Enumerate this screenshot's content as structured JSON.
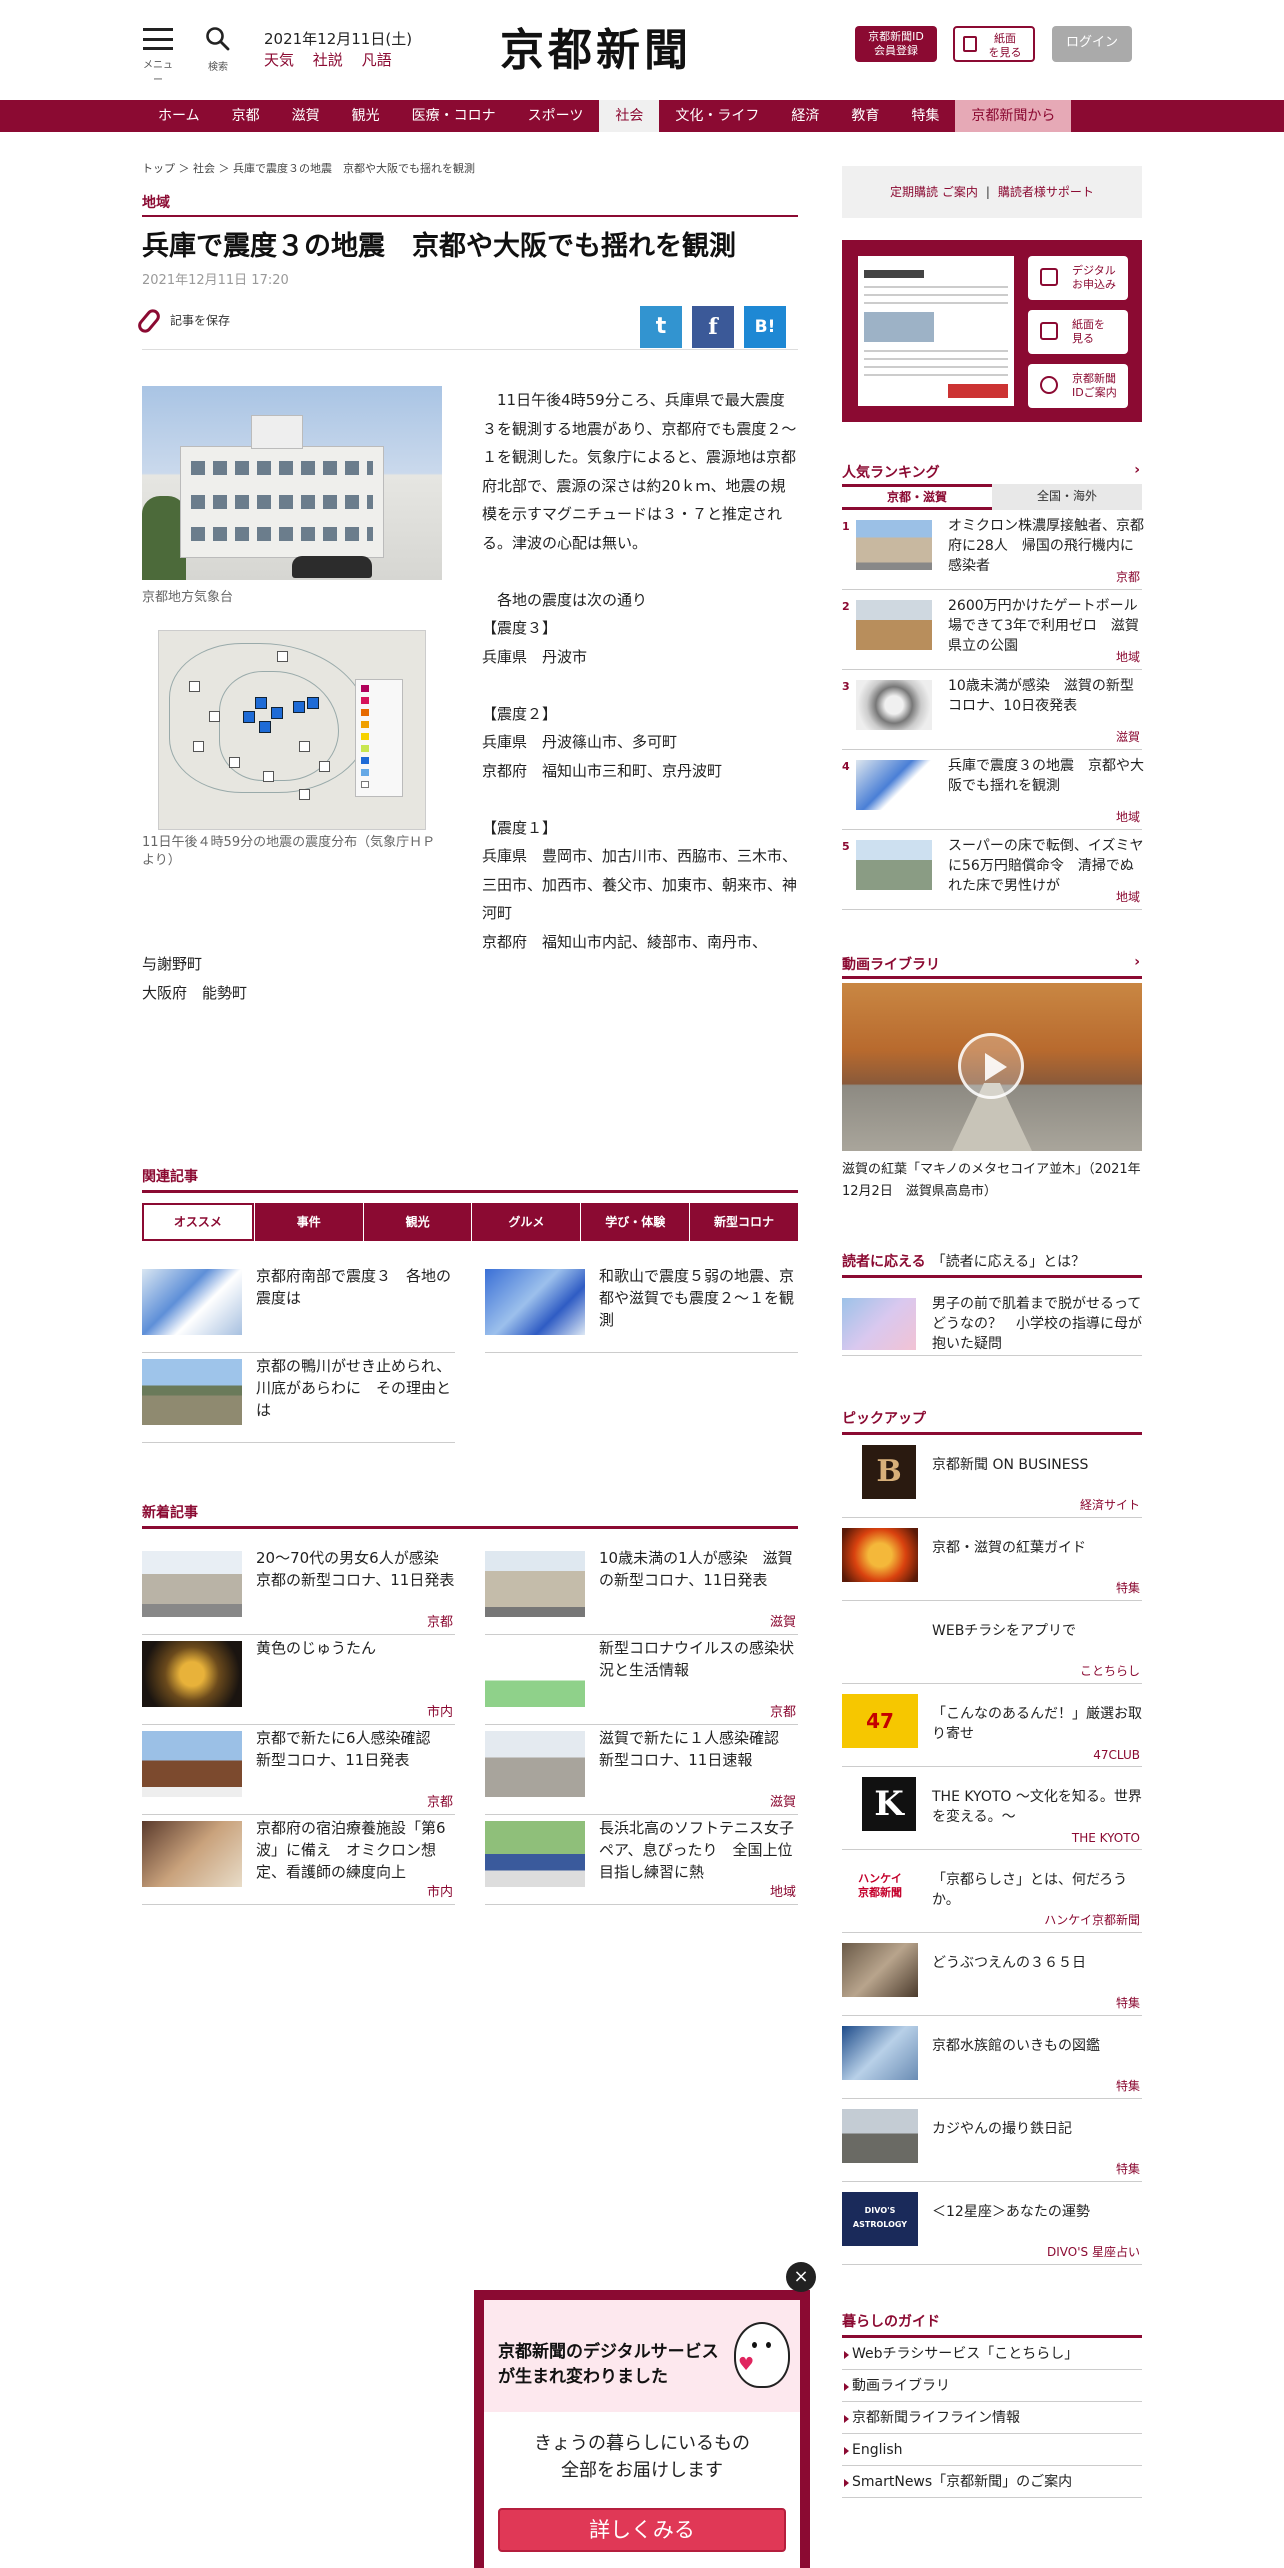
{
  "header": {
    "menu_caption": "メニュー",
    "search_caption": "検索",
    "date": "2021年12月11日(土)",
    "links": [
      "天気",
      "社説",
      "凡語"
    ],
    "logo": "京都新聞",
    "id_button": "京都新聞ID\n会員登録",
    "paper_button": "紙面\nを見る",
    "login_button": "ログイン"
  },
  "nav": [
    "ホーム",
    "京都",
    "滋賀",
    "観光",
    "医療・コロナ",
    "スポーツ",
    "社会",
    "文化・ライフ",
    "経済",
    "教育",
    "特集",
    "京都新聞から"
  ],
  "nav_active": "社会",
  "breadcrumb": "トップ ＞ 社会 ＞ 兵庫で震度３の地震　京都や大阪でも揺れを観測",
  "article": {
    "category": "地域",
    "title": "兵庫で震度３の地震　京都や大阪でも揺れを観測",
    "date": "2021年12月11日 17:20",
    "save_label": "記事を保存",
    "share": {
      "twitter": "t",
      "facebook": "f",
      "hatena": "B!"
    },
    "photo_caption": "京都地方気象台",
    "map_caption": "11日午後４時59分の地震の震度分布（気象庁ＨＰより）",
    "paragraphs": [
      "　11日午後4時59分ころ、兵庫県で最大震度３を観測する地震があり、京都府でも震度２～１を観測した。気象庁によると、震源地は京都府北部で、震源の深さは約20ｋｍ、地震の規模を示すマグニチュードは３・７と推定される。津波の心配は無い。",
      "",
      "　各地の震度は次の通り",
      "【震度３】",
      "兵庫県　丹波市",
      "",
      "【震度２】",
      "兵庫県　丹波篠山市、多可町",
      "京都府　福知山市三和町、京丹波町",
      "",
      "【震度１】",
      "兵庫県　豊岡市、加古川市、西脇市、三木市、三田市、加西市、養父市、加東市、朝来市、神河町",
      "京都府　福知山市内記、綾部市、南丹市、"
    ],
    "tail": [
      "与謝野町",
      "大阪府　能勢町"
    ]
  },
  "related": {
    "heading": "関連記事",
    "tabs": [
      "オススメ",
      "事件",
      "観光",
      "グルメ",
      "学び・体験",
      "新型コロナ"
    ],
    "items": [
      {
        "title": "京都府南部で震度３　各地の震度は",
        "tag": ""
      },
      {
        "title": "和歌山で震度５弱の地震、京都や滋賀でも震度２～１を観測",
        "tag": ""
      },
      {
        "title": "京都の鴨川がせき止められ、川底があらわに　その理由とは",
        "tag": ""
      }
    ]
  },
  "newest": {
    "heading": "新着記事",
    "items": [
      {
        "title": "20～70代の男女6人が感染　京都の新型コロナ、11日発表",
        "tag": "京都"
      },
      {
        "title": "10歳未満の1人が感染　滋賀の新型コロナ、11日発表",
        "tag": "滋賀"
      },
      {
        "title": "黄色のじゅうたん",
        "tag": "市内"
      },
      {
        "title": "新型コロナウイルスの感染状況と生活情報",
        "tag": "京都"
      },
      {
        "title": "京都で新たに6人感染確認　新型コロナ、11日発表",
        "tag": "京都"
      },
      {
        "title": "滋賀で新たに１人感染確認　新型コロナ、11日速報",
        "tag": "滋賀"
      },
      {
        "title": "京都府の宿泊療養施設「第6波」に備え　オミクロン想定、看護師の練度向上",
        "tag": "市内"
      },
      {
        "title": "長浜北高のソフトテニス女子ペア、息ぴったり　全国上位目指し練習に熱",
        "tag": "地域"
      }
    ]
  },
  "sidebar": {
    "subscribe": "定期購読 ご案内",
    "divider": "|",
    "support": "購読者様サポート",
    "paper_buttons": [
      "デジタル\nお申込み",
      "紙面を\n見る",
      "京都新聞\nIDご案内"
    ],
    "ranking_heading": "人気ランキング",
    "ranking_arrow": "›",
    "ranking_tabs": [
      "京都・滋賀",
      "全国・海外"
    ],
    "ranking": [
      {
        "num": "1",
        "title": "オミクロン株濃厚接触者、京都府に28人　帰国の飛行機内に感染者",
        "tag": "京都"
      },
      {
        "num": "2",
        "title": "2600万円かけたゲートボール場できて3年で利用ゼロ　滋賀県立の公園",
        "tag": "地域"
      },
      {
        "num": "3",
        "title": "10歳未満が感染　滋賀の新型コロナ、10日夜発表",
        "tag": "滋賀"
      },
      {
        "num": "4",
        "title": "兵庫で震度３の地震　京都や大阪でも揺れを観測",
        "tag": "地域"
      },
      {
        "num": "5",
        "title": "スーパーの床で転倒、イズミヤに56万円賠償命令　清掃でぬれた床で男性けが",
        "tag": "地域"
      }
    ],
    "video_heading": "動画ライブラリ",
    "video_arrow": "›",
    "video_caption": "滋賀の紅葉「マキノのメタセコイア並木」（2021年12月2日　滋賀県高島市）",
    "qa_heading_strong": "読者に応える",
    "qa_heading": "「読者に応える」とは？",
    "qa_title": "男子の前で肌着まで脱がせるってどうなの？　小学校の指導に母が抱いた疑問",
    "pickup_heading": "ピックアップ",
    "pickup": [
      {
        "title": "京都新聞 ON BUSINESS",
        "tag": "経済サイト"
      },
      {
        "title": "京都・滋賀の紅葉ガイド",
        "tag": "特集"
      },
      {
        "title": "WEBチラシをアプリで",
        "tag": "ことちらし"
      },
      {
        "title": "「こんなのあるんだ！」厳選お取り寄せ",
        "tag": "47CLUB"
      },
      {
        "title": "THE KYOTO ～文化を知る。世界を変える。～",
        "tag": "THE KYOTO"
      },
      {
        "title": "「京都らしさ」とは、何だろうか。",
        "tag": "ハンケイ京都新聞"
      },
      {
        "title": "どうぶつえんの３６５日",
        "tag": "特集"
      },
      {
        "title": "京都水族館のいきもの図鑑",
        "tag": "特集"
      },
      {
        "title": "カジやんの撮り鉄日記",
        "tag": "特集"
      },
      {
        "title": "＜12星座＞あなたの運勢",
        "tag": "DIVO'S 星座占い"
      }
    ],
    "pickup_logos": [
      "B",
      "",
      "",
      "47",
      "K",
      "ハンケイ\n京都新聞",
      "",
      "",
      "",
      "DIVO'S\nASTROLOGY"
    ],
    "guide_heading": "暮らしのガイド",
    "guide": [
      "Webチラシサービス「ことちらし」",
      "動画ライブラリ",
      "京都新聞ライフライン情報",
      "English",
      "SmartNews「京都新聞」のご案内"
    ]
  },
  "popup": {
    "title": "京都新聞のデジタルサービスが生まれ変わりました",
    "body": "きょうの暮らしにいるもの\n全部をお届けします",
    "cta": "詳しくみる",
    "close": "×"
  }
}
